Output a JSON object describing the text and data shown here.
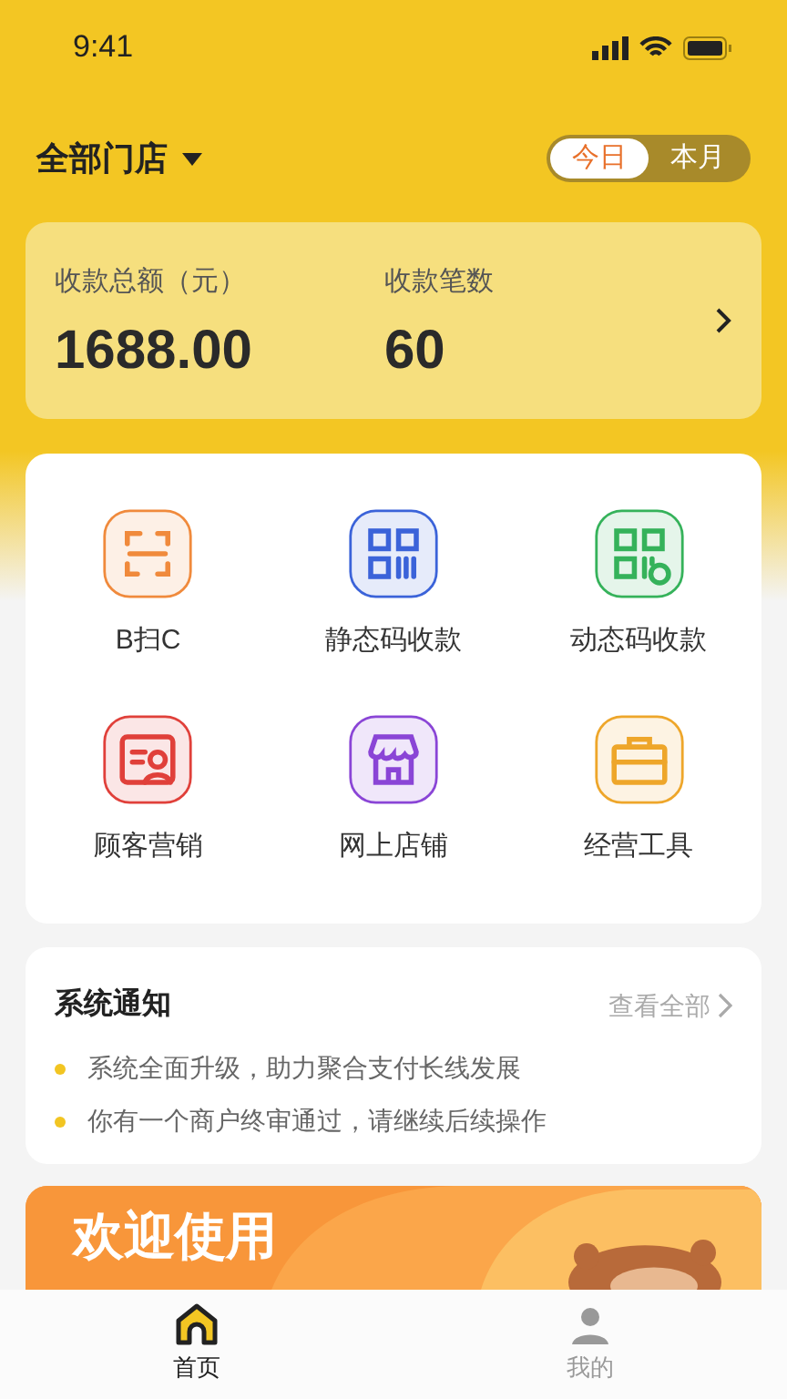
{
  "status_bar": {
    "time": "9:41"
  },
  "store_selector": {
    "label": "全部门店"
  },
  "period_tabs": [
    {
      "label": "今日",
      "selected": true
    },
    {
      "label": "本月",
      "selected": false
    }
  ],
  "summary": {
    "items": [
      {
        "label": "收款总额（元）",
        "value": "1688.00"
      },
      {
        "label": "收款笔数",
        "value": "60"
      }
    ]
  },
  "features": [
    {
      "label": "B扫C",
      "kind": "scan",
      "color": "#f08a3c"
    },
    {
      "label": "静态码收款",
      "kind": "qr",
      "color": "#3b63d9"
    },
    {
      "label": "动态码收款",
      "kind": "dynamic",
      "color": "#35b25a"
    },
    {
      "label": "顾客营销",
      "kind": "customer",
      "color": "#e0403a"
    },
    {
      "label": "网上店铺",
      "kind": "shop",
      "color": "#8a45d6"
    },
    {
      "label": "经营工具",
      "kind": "toolbox",
      "color": "#eea62a"
    }
  ],
  "notices": {
    "title": "系统通知",
    "view_all": "查看全部",
    "items": [
      "系统全面升级，助力聚合支付长线发展",
      "你有一个商户终审通过，请继续后续操作"
    ]
  },
  "banner": {
    "title": "欢迎使用"
  },
  "tab_bar": [
    {
      "label": "首页",
      "kind": "home",
      "selected": true
    },
    {
      "label": "我的",
      "kind": "user",
      "selected": false
    }
  ]
}
